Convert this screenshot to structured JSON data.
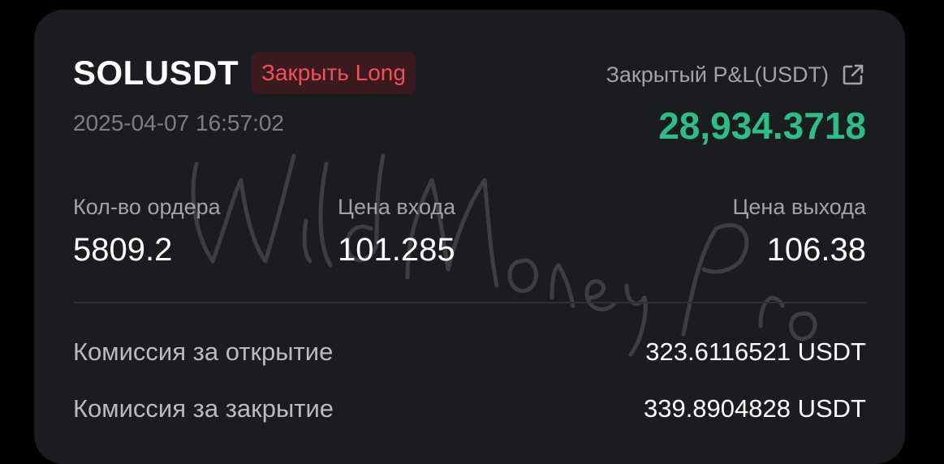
{
  "trade": {
    "symbol": "SOLUSDT",
    "side_badge": "Закрыть Long",
    "timestamp": "2025-04-07 16:57:02"
  },
  "pnl": {
    "label": "Закрытый P&L(USDT)",
    "value": "28,934.3718",
    "share_icon": "share-external-icon"
  },
  "stats": [
    {
      "label": "Кол-во ордера",
      "value": "5809.2"
    },
    {
      "label": "Цена входа",
      "value": "101.285"
    },
    {
      "label": "Цена выхода",
      "value": "106.38"
    }
  ],
  "fees": [
    {
      "label": "Комиссия за открытие",
      "value": "323.6116521 USDT"
    },
    {
      "label": "Комиссия за закрытие",
      "value": "339.8904828 USDT"
    }
  ],
  "watermark": {
    "text": "Wild Money Pro"
  },
  "colors": {
    "background": "#000000",
    "card": "#1b1c1f",
    "profit_green": "#2dbd85",
    "badge_red": "#f0505c",
    "badge_bg": "#3a1a1e"
  }
}
